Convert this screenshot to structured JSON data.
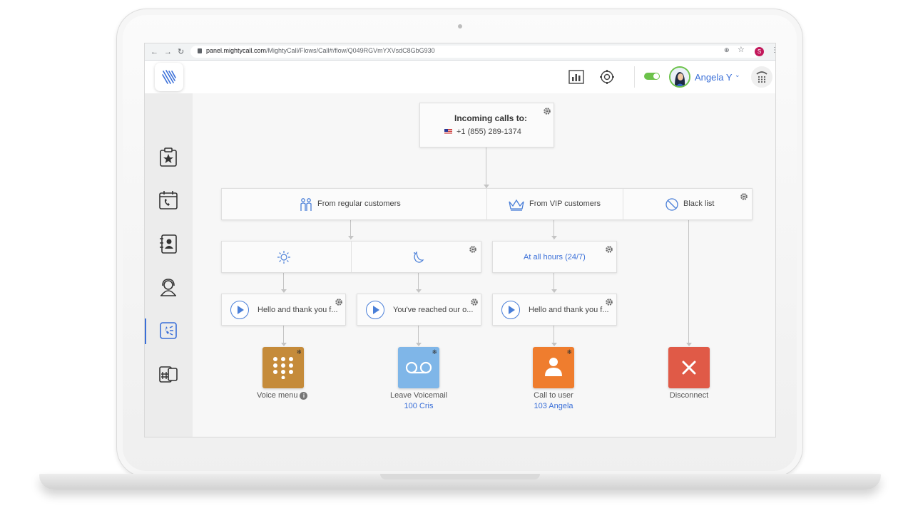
{
  "browser": {
    "url_host": "panel.mightycall.com",
    "url_path": "/MightyCall/Flows/Call#/flow/Q049RGVmYXVsdC8GbG930",
    "nav_back": "←",
    "nav_forward": "→",
    "nav_reload": "↻",
    "profile_initial": "S",
    "menu_glyph": "⋮",
    "zoom_glyph": "⊕",
    "star_glyph": "☆"
  },
  "header": {
    "user_name": "Angela Y",
    "chevron": "⌄",
    "status_toggle_on": true,
    "accent_color": "#3a6fd8",
    "status_color": "#6cc24a"
  },
  "sidebar": {
    "items": [
      {
        "icon": "clipboard-star-icon"
      },
      {
        "icon": "calendar-phone-icon"
      },
      {
        "icon": "contacts-book-icon"
      },
      {
        "icon": "agent-headset-icon"
      },
      {
        "icon": "call-flow-icon",
        "active": true
      },
      {
        "icon": "phone-number-icon"
      }
    ]
  },
  "flow": {
    "root": {
      "title": "Incoming calls to:",
      "phone": "+1 (855) 289-1374"
    },
    "branches": [
      {
        "label": "From regular customers",
        "icon": "people-icon"
      },
      {
        "label": "From VIP customers",
        "icon": "crown-icon"
      },
      {
        "label": "Black list",
        "icon": "block-icon"
      }
    ],
    "schedules": {
      "regular_day_icon": "sun-icon",
      "regular_night_icon": "moon-icon",
      "vip": "At all hours (24/7)"
    },
    "greetings": [
      {
        "text": "Hello and thank you f..."
      },
      {
        "text": "You've reached our o..."
      },
      {
        "text": "Hello and thank you f..."
      }
    ],
    "actions": [
      {
        "label": "Voice menu",
        "sub": "",
        "color": "#c58b3a",
        "icon": "keypad-icon",
        "info": "i"
      },
      {
        "label": "Leave Voicemail",
        "sub": "100 Cris",
        "color": "#7fb6e8",
        "icon": "voicemail-icon"
      },
      {
        "label": "Call to user",
        "sub": "103 Angela",
        "color": "#ef7d2e",
        "icon": "user-icon"
      },
      {
        "label": "Disconnect",
        "sub": "",
        "color": "#e05a47",
        "icon": "close-icon"
      }
    ]
  }
}
